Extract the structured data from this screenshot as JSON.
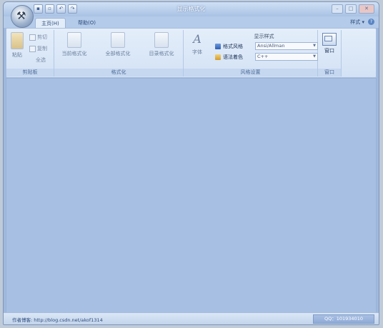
{
  "window": {
    "title": "显示格式化"
  },
  "quick_access": {
    "items": [
      "save-icon",
      "open-icon",
      "undo-icon",
      "redo-icon"
    ]
  },
  "tabs": [
    {
      "label": "主页(H)"
    },
    {
      "label": "帮助(O)"
    }
  ],
  "style_menu": {
    "label": "样式 ▾"
  },
  "ribbon": {
    "clipboard": {
      "label": "剪贴板",
      "paste": "粘贴",
      "cut": "剪切",
      "copy": "复制",
      "select_all": "全选"
    },
    "format": {
      "label": "格式化",
      "current": "当前格式化",
      "all": "全部格式化",
      "selected": "目录格式化"
    },
    "style_settings": {
      "label": "风格设置",
      "font": "字体",
      "title": "显示样式",
      "format_style_label": "格式风格",
      "format_style_value": "Ansi/Allman",
      "syntax_color_label": "语法着色",
      "syntax_color_value": "C++"
    },
    "window_group": {
      "label": "窗口",
      "window_btn": "窗口"
    }
  },
  "status": {
    "left": "作者博客: http://blog.csdn.net/akof1314",
    "right": "QQ：101934010"
  }
}
